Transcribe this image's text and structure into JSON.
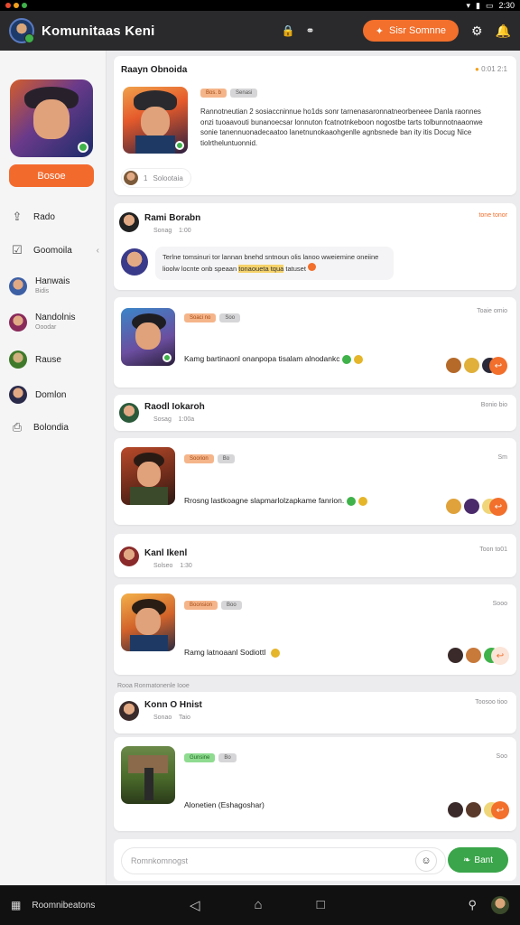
{
  "statusbar": {
    "time": "2:30"
  },
  "header": {
    "title": "Komunitaas Keni",
    "cta_label": "Sisr Somnne"
  },
  "sidebar": {
    "primary_label": "Bosoe",
    "items": [
      {
        "label": "Rado"
      },
      {
        "label": "Goomoila"
      },
      {
        "label": "Hanwais",
        "sub": "Bidis"
      },
      {
        "label": "Nandolnis",
        "sub": "Ooodar"
      },
      {
        "label": "Rause"
      },
      {
        "label": "Domlon"
      },
      {
        "label": "Bolondia"
      }
    ]
  },
  "post": {
    "title": "Raayn Obnoida",
    "meta_right": "0:01 2:1",
    "tag1": "Bos. b",
    "tag2": "Senasi",
    "body": "Rannotneutian 2 sosiaccninnue ho1ds sonr tarnenasaronnatneorbeneee Danla raonnes onzi tuoaavouti bunanoecsar lonnuton fcatnotnkeboon nogostbe tarts tolbunnotnaaonwe sonie tanennuonadecaatoo lanetnunokaaohgenlle agnbsnede ban ity itis Docug Nice tiolrtheluntuonnid.",
    "footer_count": "1",
    "footer_text": "Solootaia"
  },
  "threads": [
    {
      "name": "Rami Borabn",
      "m1": "Sonag",
      "m2": "1:00",
      "time": "tone tonor",
      "reply_text": "Terlne tomsinuri tor lannan bnehd sntnoun olis lanoo wweiemine oneiine lioolw locnte onb speaan",
      "reply_hl": "tonaoueta tqua",
      "reply_tail": "tatuset"
    },
    {
      "tags": [
        "Soaci no",
        "Soo"
      ],
      "time": "Toaie omio",
      "text": "Kamg bartinaonl onanpopa tisalam alnodankc"
    },
    {
      "name": "Raodl Iokaroh",
      "m1": "Sosag",
      "m2": "1:00a",
      "time": "Bonio bio"
    },
    {
      "tags": [
        "Soorion",
        "Bo"
      ],
      "time": "Sm",
      "text": "Rrosng lastkoagne slapmarlolzapkame fanrion."
    },
    {
      "name": "Kanl Ikenl",
      "m1": "Solseo",
      "m2": "1:30",
      "time": "Toon to01"
    },
    {
      "tags": [
        "Boonsion",
        "Boo"
      ],
      "time": "Sooo",
      "text": "Ramg latnoaanl Sodiottl"
    },
    {
      "divider": "Rooa Ronmatonenle Iooe",
      "name": "Konn O Hnist",
      "m1": "Sonao",
      "m2": "Taio",
      "time": "Toosoo tioo"
    },
    {
      "tags": [
        "Gunsine",
        "Bo"
      ],
      "time": "Soo",
      "text": "Alonetien (Eshagoshar)"
    }
  ],
  "composer": {
    "placeholder": "Romnkomnogst",
    "send_label": "Bant"
  },
  "bottom": {
    "label": "Roomnibeatons"
  }
}
